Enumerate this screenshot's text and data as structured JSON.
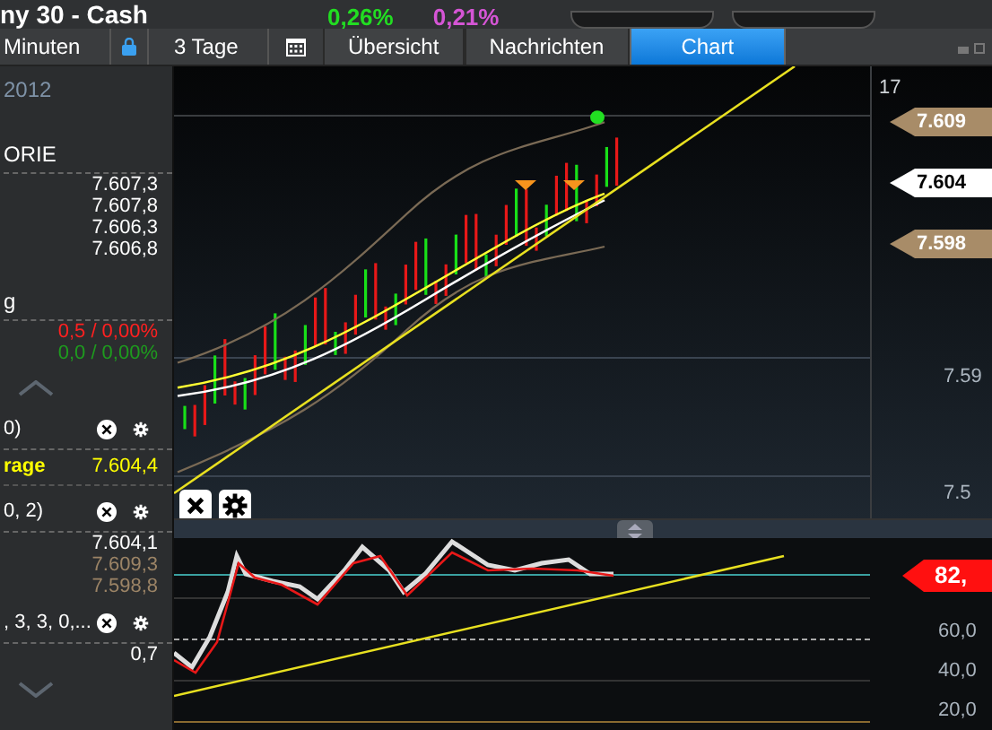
{
  "header": {
    "title": "ny 30 - Cash",
    "change_points": "0,26%",
    "change_pct": "0,21%"
  },
  "toolbar": {
    "period": "Minuten",
    "range": "3 Tage",
    "tabs": [
      {
        "label": "Übersicht",
        "selected": false
      },
      {
        "label": "Nachrichten",
        "selected": false
      },
      {
        "label": "Chart",
        "selected": true
      }
    ]
  },
  "left_panel": [
    {
      "kind": "date",
      "label": "2012"
    },
    {
      "kind": "heading",
      "label": "ORIE"
    },
    {
      "kind": "value",
      "value": "7.607,3",
      "color": "#ffffff"
    },
    {
      "kind": "value",
      "value": "7.607,8",
      "color": "#ffffff"
    },
    {
      "kind": "value",
      "value": "7.606,3",
      "color": "#ffffff"
    },
    {
      "kind": "value",
      "value": "7.606,8",
      "color": "#ffffff"
    },
    {
      "kind": "heading",
      "label": "g"
    },
    {
      "kind": "value",
      "value": "0,5 / 0,00%",
      "color": "#ff2020"
    },
    {
      "kind": "value",
      "value": "0,0 / 0,00%",
      "color": "#1e9a1e"
    },
    {
      "kind": "collapse"
    },
    {
      "kind": "indicator",
      "label": "0)"
    },
    {
      "kind": "pair",
      "label": "rage",
      "value": "7.604,4",
      "color": "#ffff00"
    },
    {
      "kind": "indicator",
      "label": "0, 2)"
    },
    {
      "kind": "value",
      "value": "7.604,1",
      "color": "#ffffff"
    },
    {
      "kind": "value",
      "value": "7.609,3",
      "color": "#9c8466"
    },
    {
      "kind": "value",
      "value": "7.598,8",
      "color": "#9c8466"
    },
    {
      "kind": "indicator",
      "label": ", 3, 3, 0,..."
    },
    {
      "kind": "value",
      "value": "0,7",
      "color": "#ffffff"
    },
    {
      "kind": "expand"
    }
  ],
  "price_axis": {
    "top_label": "17",
    "tags": [
      {
        "value": "7.609",
        "color": "#a88c68"
      },
      {
        "value": "7.604",
        "color": "#ffffff"
      },
      {
        "value": "7.598",
        "color": "#a88c68"
      }
    ],
    "ticks": [
      "7.59",
      "7.5"
    ]
  },
  "oscillator_axis": {
    "tag": "82,",
    "ticks": [
      "60,0",
      "40,0",
      "20,0"
    ]
  }
}
